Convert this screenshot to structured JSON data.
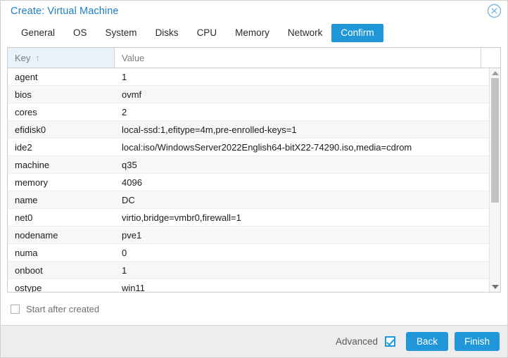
{
  "window": {
    "title": "Create: Virtual Machine",
    "close_icon": "close-circle-icon"
  },
  "tabs": [
    {
      "label": "General",
      "active": false
    },
    {
      "label": "OS",
      "active": false
    },
    {
      "label": "System",
      "active": false
    },
    {
      "label": "Disks",
      "active": false
    },
    {
      "label": "CPU",
      "active": false
    },
    {
      "label": "Memory",
      "active": false
    },
    {
      "label": "Network",
      "active": false
    },
    {
      "label": "Confirm",
      "active": true
    }
  ],
  "grid": {
    "columns": [
      {
        "label": "Key",
        "sorted": true,
        "sort_icon": "↑"
      },
      {
        "label": "Value",
        "sorted": false,
        "sort_icon": ""
      },
      {
        "label": "",
        "sorted": false,
        "sort_icon": ""
      }
    ],
    "rows": [
      {
        "key": "agent",
        "value": "1"
      },
      {
        "key": "bios",
        "value": "ovmf"
      },
      {
        "key": "cores",
        "value": "2"
      },
      {
        "key": "efidisk0",
        "value": "local-ssd:1,efitype=4m,pre-enrolled-keys=1"
      },
      {
        "key": "ide2",
        "value": "local:iso/WindowsServer2022English64-bitX22-74290.iso,media=cdrom"
      },
      {
        "key": "machine",
        "value": "q35"
      },
      {
        "key": "memory",
        "value": "4096"
      },
      {
        "key": "name",
        "value": "DC"
      },
      {
        "key": "net0",
        "value": "virtio,bridge=vmbr0,firewall=1"
      },
      {
        "key": "nodename",
        "value": "pve1"
      },
      {
        "key": "numa",
        "value": "0"
      },
      {
        "key": "onboot",
        "value": "1"
      },
      {
        "key": "ostype",
        "value": "win11"
      }
    ],
    "scrollbar": {
      "up_icon": "scroll-up-arrow-icon",
      "down_icon": "scroll-down-arrow-icon",
      "thumb_position_percent": 0
    }
  },
  "options": {
    "start_after_created_label": "Start after created",
    "start_after_created_checked": false
  },
  "footer": {
    "advanced_label": "Advanced",
    "advanced_checked": true,
    "back_label": "Back",
    "finish_label": "Finish"
  },
  "colors": {
    "accent": "#1f97d8",
    "title": "#1f7ec2",
    "sorted_header_bg": "#e8f2fb",
    "footer_bg": "#ededed"
  }
}
